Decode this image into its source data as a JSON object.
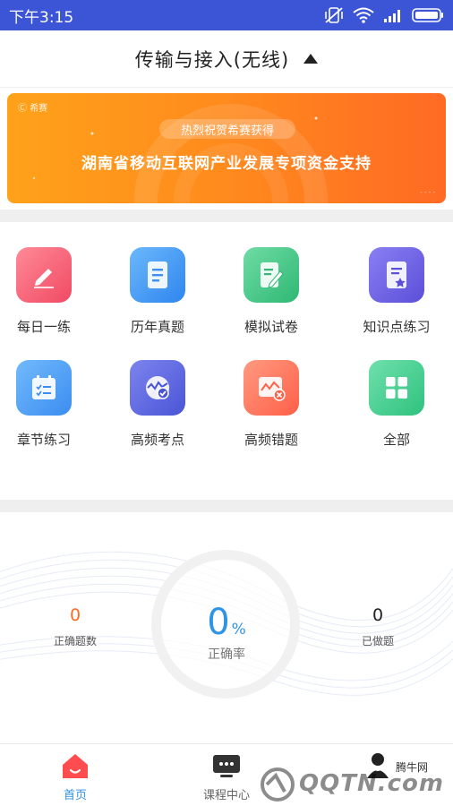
{
  "status_bar": {
    "time": "下午3:15",
    "icons": [
      "vibrate-off-icon",
      "wifi-icon",
      "signal-icon",
      "battery-icon"
    ]
  },
  "header": {
    "title": "传输与接入(无线)",
    "caret_icon": "caret-up-icon"
  },
  "banner": {
    "brand": "希赛",
    "pill_text": "热烈祝贺希赛获得",
    "main_text": "湖南省移动互联网产业发展专项资金支持",
    "colors": {
      "start": "#ffa21a",
      "end": "#ff6a24"
    }
  },
  "grid": {
    "items": [
      {
        "label": "每日一练",
        "icon": "pencil-icon",
        "color": "#f5566d"
      },
      {
        "label": "历年真题",
        "icon": "document-icon",
        "color": "#3f9bf5"
      },
      {
        "label": "模拟试卷",
        "icon": "edit-note-icon",
        "color": "#35c47c"
      },
      {
        "label": "知识点练习",
        "icon": "star-document-icon",
        "color": "#6f63e8"
      },
      {
        "label": "章节练习",
        "icon": "checklist-calendar-icon",
        "color": "#3f9bf5"
      },
      {
        "label": "高频考点",
        "icon": "check-badge-icon",
        "color": "#5763df"
      },
      {
        "label": "高频错题",
        "icon": "error-chart-icon",
        "color": "#ff6f55"
      },
      {
        "label": "全部",
        "icon": "grid-squares-icon",
        "color": "#3ccc88"
      }
    ]
  },
  "stats": {
    "correct_count": {
      "value": "0",
      "label": "正确题数",
      "color": "#ff6a24"
    },
    "accuracy": {
      "value": "0",
      "unit": "%",
      "label": "正确率",
      "color": "#2f93e6"
    },
    "done_count": {
      "value": "0",
      "label": "已做题",
      "color": "#222222"
    }
  },
  "tabbar": {
    "tabs": [
      {
        "label": "首页",
        "icon": "home-icon",
        "active": true
      },
      {
        "label": "课程中心",
        "icon": "video-course-icon",
        "active": false
      },
      {
        "label": "",
        "icon": "user-icon",
        "active": false
      }
    ],
    "active_color": "#2f93e6",
    "accent_color": "#ff4d4f"
  },
  "watermark": {
    "text": "QQTN.com",
    "sub": "腾牛网"
  }
}
